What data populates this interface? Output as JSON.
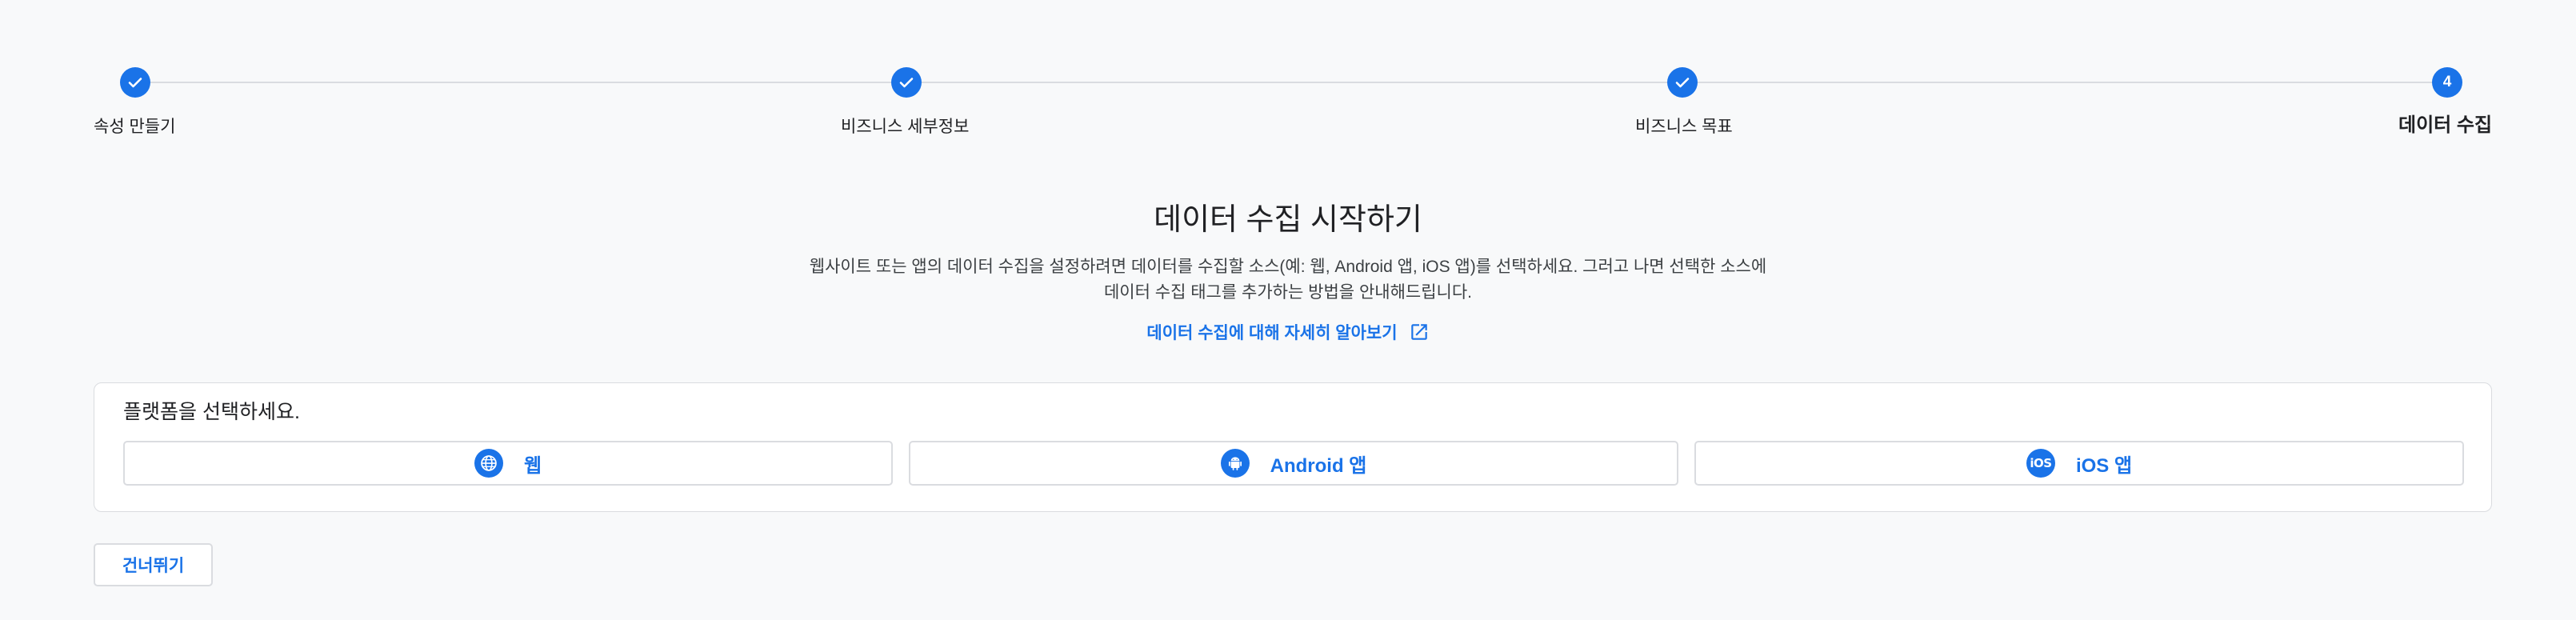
{
  "stepper": {
    "steps": [
      {
        "label": "속성 만들기",
        "state": "completed",
        "icon": "check-icon"
      },
      {
        "label": "비즈니스 세부정보",
        "state": "completed",
        "icon": "check-icon"
      },
      {
        "label": "비즈니스 목표",
        "state": "completed",
        "icon": "check-icon"
      },
      {
        "label": "데이터 수집",
        "state": "current",
        "number": "4"
      }
    ]
  },
  "intro": {
    "title": "데이터 수집 시작하기",
    "description": "웹사이트 또는 앱의 데이터 수집을 설정하려면 데이터를 수집할 소스(예: 웹, Android 앱, iOS 앱)를 선택하세요. 그러고 나면 선택한 소스에 데이터 수집 태그를 추가하는 방법을 안내해드립니다.",
    "learn_more_link": "데이터 수집에 대해 자세히 알아보기",
    "learn_more_icon": "open-in-new-icon"
  },
  "platform": {
    "heading": "플랫폼을 선택하세요.",
    "options": [
      {
        "label": "웹",
        "icon": "globe-icon"
      },
      {
        "label": "Android 앱",
        "icon": "android-icon"
      },
      {
        "label": "iOS 앱",
        "icon": "ios-icon",
        "icon_text": "iOS"
      }
    ]
  },
  "actions": {
    "skip_label": "건너뛰기"
  },
  "colors": {
    "accent": "#1a73e8",
    "background": "#f8f9fa",
    "border": "#dadce0",
    "text_primary": "#202124"
  }
}
